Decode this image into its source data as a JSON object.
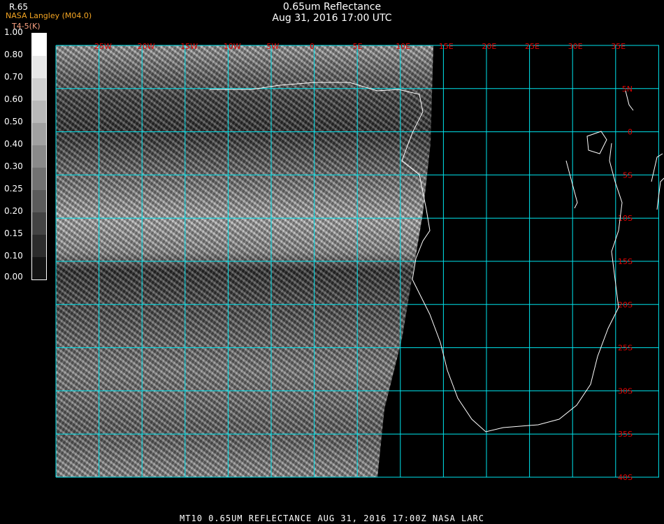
{
  "title": {
    "line1": "0.65um Reflectance",
    "line2": "Aug 31, 2016 17:00 UTC"
  },
  "branding": "NASA Langley (M04.0)",
  "product_label": "R.65",
  "unit_label": "T4-5(K)",
  "colorbar": {
    "ticks": [
      "1.00",
      "0.80",
      "0.70",
      "0.60",
      "0.50",
      "0.40",
      "0.30",
      "0.25",
      "0.20",
      "0.15",
      "0.10",
      "0.00"
    ]
  },
  "lon_labels": [
    "25W",
    "20W",
    "15W",
    "10W",
    "5W",
    "0",
    "5E",
    "10E",
    "15E",
    "20E",
    "25E",
    "30E",
    "35E"
  ],
  "lat_labels": [
    "5N",
    "0",
    "5S",
    "10S",
    "15S",
    "20S",
    "25S",
    "30S",
    "35S",
    "40S"
  ],
  "footer": "MT10  0.65UM REFLECTANCE   AUG 31, 2016 17:00Z   NASA LARC",
  "colors": {
    "grid": "#00e5ee",
    "labels": "#e00000",
    "brand": "#f5a623"
  }
}
